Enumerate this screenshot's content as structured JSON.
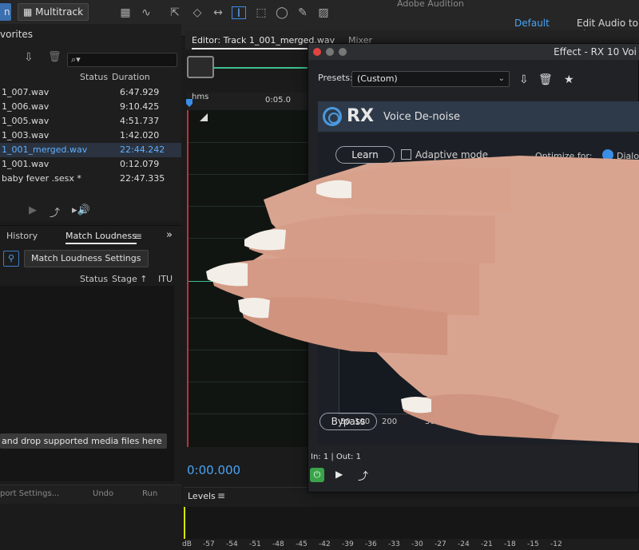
{
  "app": {
    "title": "Adobe Audition"
  },
  "toolbar": {
    "waveform_tab": "n",
    "multitrack_label": "Multitrack",
    "workspace_default": "Default",
    "workspace_edit": "Edit Audio to Vic"
  },
  "files": {
    "panel_title": "vorites",
    "col_status": "Status",
    "col_duration": "Duration",
    "rows": [
      {
        "name": "1_007.wav",
        "duration": "6:47.929"
      },
      {
        "name": "1_006.wav",
        "duration": "9:10.425"
      },
      {
        "name": "1_005.wav",
        "duration": "4:51.737"
      },
      {
        "name": "1_003.wav",
        "duration": "1:42.020"
      },
      {
        "name": "1_001_merged.wav",
        "duration": "22:44.242"
      },
      {
        "name": "1_001.wav",
        "duration": "0:12.079"
      },
      {
        "name": "baby fever .sesx *",
        "duration": "22:47.335"
      }
    ]
  },
  "history": {
    "tab_history": "History",
    "tab_match_loudness": "Match Loudness",
    "settings_button": "Match Loudness Settings",
    "col_status": "Status",
    "col_stage": "Stage ↑",
    "col_itu": "ITU",
    "drop_hint": "and drop supported media files here"
  },
  "bottom_left": {
    "export": "port Settings...",
    "undo": "Undo",
    "run": "Run"
  },
  "editor": {
    "tab_label": "Editor: Track 1_001_merged.wav",
    "mixer_label": "Mixer",
    "ruler_unit": "hms",
    "ruler_mark": "0:05.0",
    "time": "0:00.000"
  },
  "levels": {
    "title": "Levels",
    "scale": [
      "dB",
      "-57",
      "-54",
      "-51",
      "-48",
      "-45",
      "-42",
      "-39",
      "-36",
      "-33",
      "-30",
      "-27",
      "-24",
      "-21",
      "-18",
      "-15",
      "-12"
    ]
  },
  "plugin": {
    "title": "Effect - RX 10 Voi",
    "presets_label": "Presets:",
    "presets_value": "(Custom)",
    "brand": "RX",
    "module": "Voice De-noise",
    "learn": "Learn",
    "adaptive": "Adaptive mode",
    "optimize_label": "Optimize for:",
    "optimize_value": "Dialo",
    "freq_labels": [
      "50",
      "100",
      "200",
      "500"
    ],
    "bypass": "Bypass",
    "io": "In: 1 | Out: 1"
  },
  "colors": {
    "accent": "#4ba3f5",
    "waveform": "#3fbf8f",
    "playhead": "#c0303a",
    "power": "#3aa34a"
  }
}
